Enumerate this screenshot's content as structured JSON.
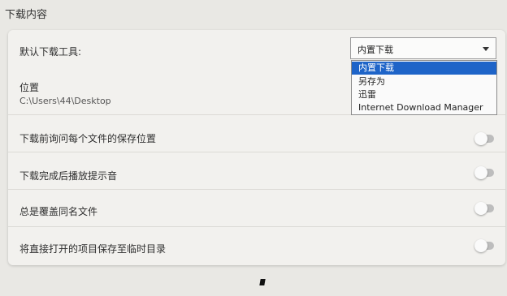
{
  "section": {
    "title": "下载内容"
  },
  "settings": {
    "default_tool_label": "默认下载工具:",
    "location_label": "位置",
    "location_path": "C:\\Users\\44\\Desktop",
    "toggles": [
      {
        "label": "下载前询问每个文件的保存位置",
        "on": false
      },
      {
        "label": "下载完成后播放提示音",
        "on": false
      },
      {
        "label": "总是覆盖同名文件",
        "on": false
      },
      {
        "label": "将直接打开的项目保存至临时目录",
        "on": false
      }
    ]
  },
  "download_tool_select": {
    "selected": "内置下载",
    "options": [
      "内置下载",
      "另存为",
      "迅雷",
      "Internet Download Manager"
    ],
    "highlighted_index": 0
  },
  "colors": {
    "page_bg": "#e9e8e4",
    "card_bg": "#f2f1ee",
    "highlight": "#1e64c8"
  },
  "icons": {
    "select_caret": "chevron-down-icon"
  }
}
